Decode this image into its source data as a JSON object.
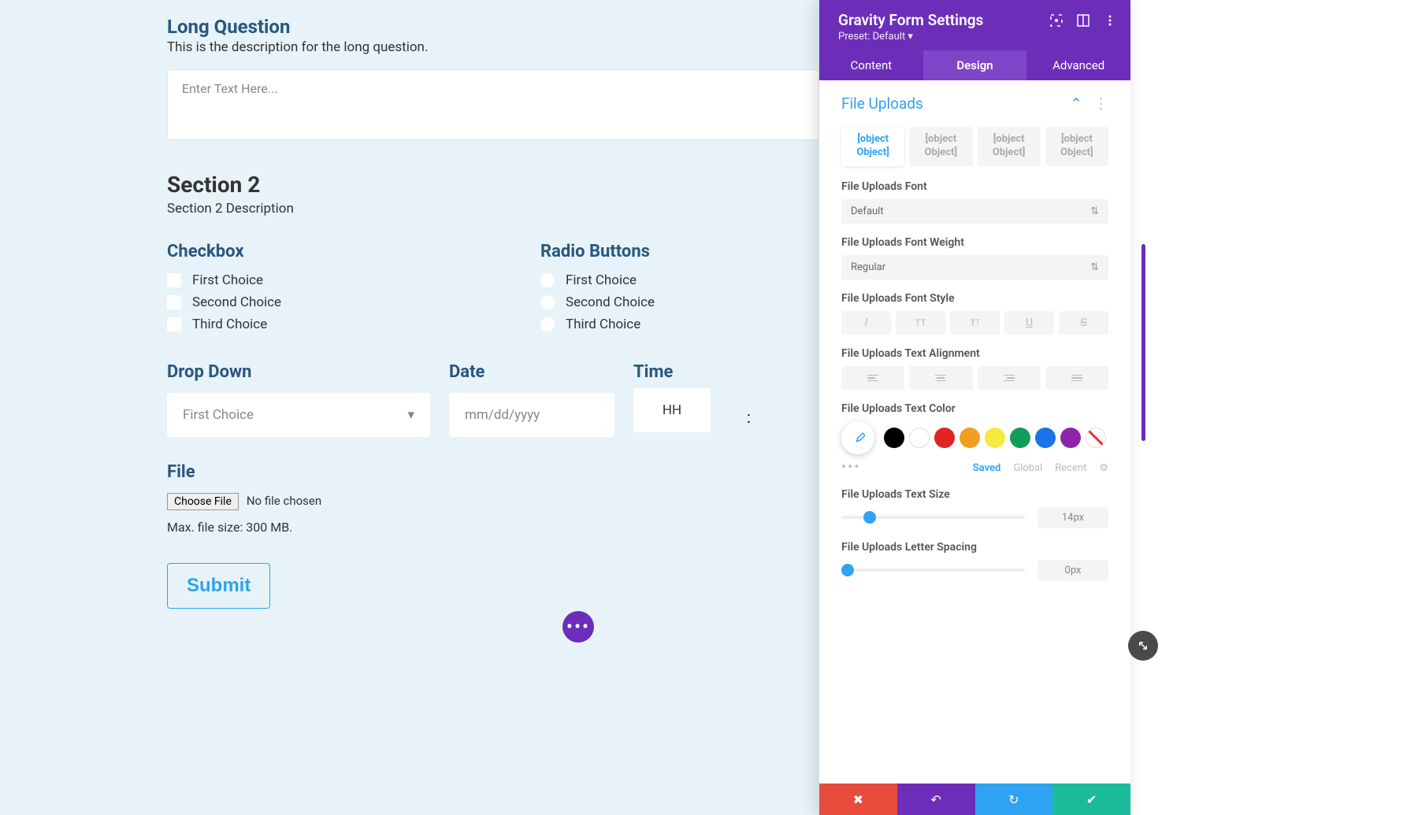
{
  "form": {
    "long_q_title": "Long Question",
    "long_q_desc": "This is the description for the long question.",
    "long_q_placeholder": "Enter Text Here...",
    "section2_title": "Section 2",
    "section2_desc": "Section 2 Description",
    "checkbox_label": "Checkbox",
    "radio_label": "Radio Buttons",
    "choices": [
      "First Choice",
      "Second Choice",
      "Third Choice"
    ],
    "dropdown_label": "Drop Down",
    "dropdown_value": "First Choice",
    "date_label": "Date",
    "date_placeholder": "mm/dd/yyyy",
    "time_label": "Time",
    "time_hh": "HH",
    "time_sep": ":",
    "file_label": "File",
    "choose_file": "Choose File",
    "no_file": "No file chosen",
    "file_hint": "Max. file size: 300 MB.",
    "submit": "Submit"
  },
  "panel": {
    "title": "Gravity Form Settings",
    "preset": "Preset: Default ▾",
    "tabs": {
      "content": "Content",
      "design": "Design",
      "advanced": "Advanced"
    },
    "section": "File Uploads",
    "obj_tabs": [
      "[object Object]",
      "[object Object]",
      "[object Object]",
      "[object Object]"
    ],
    "labels": {
      "font": "File Uploads Font",
      "font_value": "Default",
      "weight": "File Uploads Font Weight",
      "weight_value": "Regular",
      "style": "File Uploads Font Style",
      "align": "File Uploads Text Alignment",
      "color": "File Uploads Text Color",
      "size": "File Uploads Text Size",
      "size_value": "14px",
      "spacing": "File Uploads Letter Spacing",
      "spacing_value": "0px"
    },
    "swatch_meta": {
      "saved": "Saved",
      "global": "Global",
      "recent": "Recent"
    },
    "colors": {
      "black": "#000000",
      "red": "#e02424",
      "orange": "#f0a020",
      "yellow": "#f5e942",
      "green": "#0f9d58",
      "blue": "#1a73e8",
      "purple": "#8e24aa"
    }
  }
}
